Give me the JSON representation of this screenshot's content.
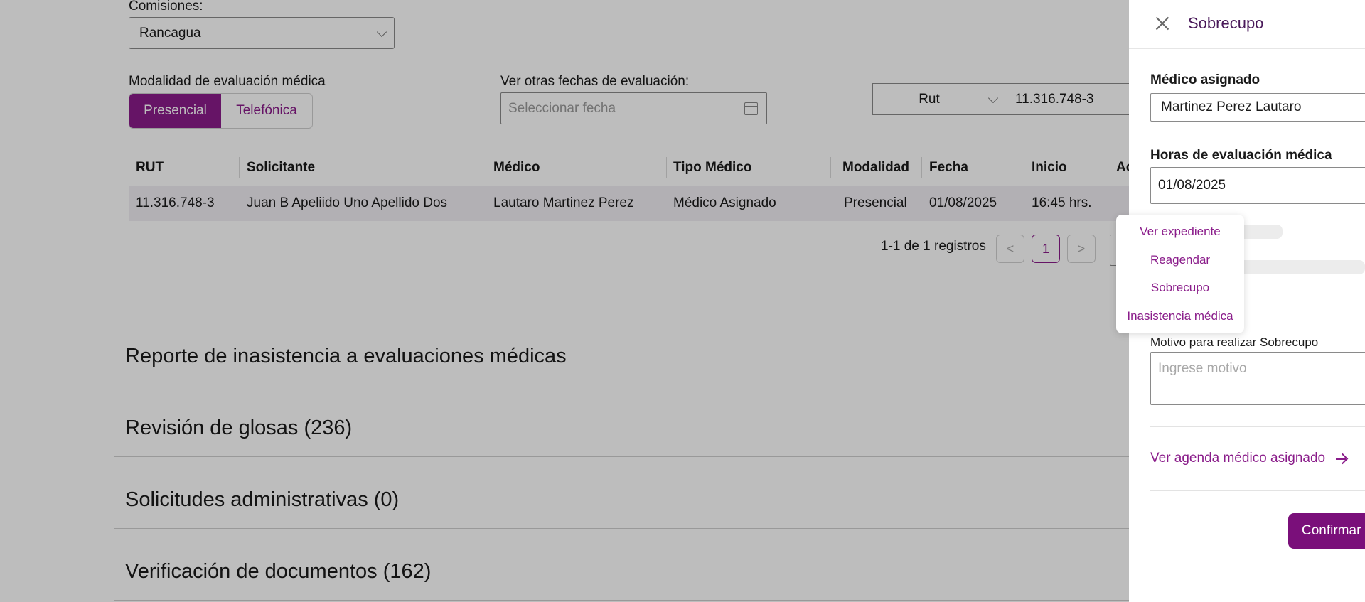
{
  "filters": {
    "comisiones_label": "Comisiones:",
    "comisiones_value": "Rancagua",
    "modalidad_label": "Modalidad de evaluación médica",
    "modalidad_options": [
      "Presencial",
      "Telefónica"
    ],
    "modalidad_selected": "Presencial",
    "fechas_label": "Ver otras fechas de evaluación:",
    "fechas_placeholder": "Seleccionar fecha",
    "search_type": "Rut",
    "search_value": "11.316.748-3"
  },
  "table": {
    "headers": [
      "RUT",
      "Solicitante",
      "Médico",
      "Tipo Médico",
      "Modalidad",
      "Fecha",
      "Inicio",
      "Ac"
    ],
    "rows": [
      [
        "11.316.748-3",
        "Juan B Apeliido Uno Apellido Dos",
        "Lautaro Martinez Perez",
        "Médico Asignado",
        "Presencial",
        "01/08/2025",
        "16:45 hrs."
      ]
    ]
  },
  "pagination": {
    "summary": "1-1 de 1 registros",
    "prev": "<",
    "current_page": "1",
    "next": ">"
  },
  "sections": [
    "Reporte de inasistencia a evaluaciones médicas",
    "Revisión de glosas (236)",
    "Solicitudes administrativas (0)",
    "Verificación de documentos (162)"
  ],
  "action_menu": {
    "items": [
      "Ver expediente",
      "Reagendar",
      "Sobrecupo",
      "Inasistencia médica"
    ]
  },
  "drawer": {
    "title": "Sobrecupo",
    "medico_label": "Médico asignado",
    "medico_value": "Martinez Perez Lautaro",
    "horas_label": "Horas de evaluación médica",
    "horas_value": "01/08/2025",
    "motivo_label": "Motivo para realizar Sobrecupo",
    "motivo_placeholder": "Ingrese motivo",
    "agenda_link": "Ver agenda médico asignado",
    "confirm_label": "Confirmar"
  },
  "colors": {
    "brand": "#8a1c8a",
    "overlay": "rgba(0,0,0,0.26)"
  }
}
